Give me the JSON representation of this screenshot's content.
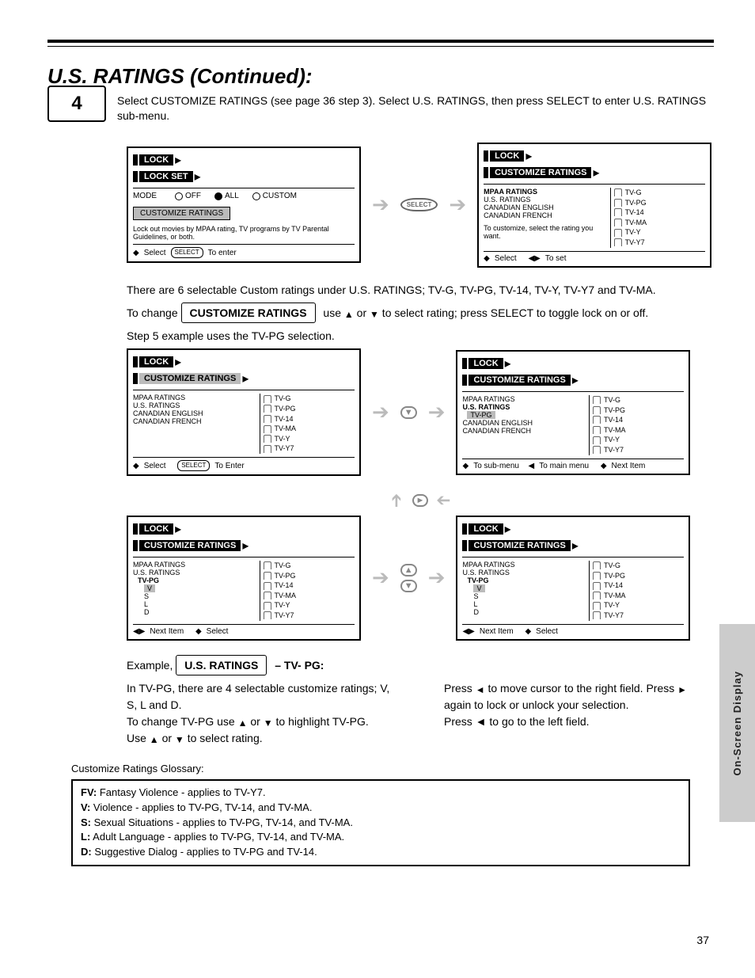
{
  "header": "U.S. RATINGS (Continued):",
  "sidebar_label": "On-Screen Display",
  "step": {
    "num": "4",
    "text": "Select CUSTOMIZE RATINGS (see page 36 step 3). Select U.S. RATINGS, then press SELECT to enter U.S. RATINGS sub-menu."
  },
  "p1": "There are 6 selectable Custom ratings under U.S. RATINGS; TV-G, TV-PG, TV-14, TV-Y, TV-Y7 and TV-MA.",
  "change_prefix": "To change",
  "change_boxlabel": "CUSTOMIZE RATINGS",
  "change_suffix_a": " use ",
  "change_suffix_b": " or ",
  "change_suffix_c": " to select rating; press SELECT to toggle lock on or off.",
  "p2": "Step 5 example uses the TV-PG selection.",
  "ex_title_prefix": "Example, ",
  "ex_title_box": "U.S. RATINGS",
  "ex_title_suffix": " – TV- PG:",
  "ex_p1": "In TV-PG, there are 4 selectable customize ratings; V, S, L and D.",
  "ex_change_prefix": "To change TV-PG use ",
  "ex_change_mid": " or ",
  "ex_change_end": " to highlight TV-PG.",
  "ex_p2_a": "Use ",
  "ex_p2_b": " or ",
  "ex_p2_c": " to select rating.",
  "ex_p3_a": " to move cursor to the right field. Press ",
  "ex_p3_b": " again to lock or unlock your selection.",
  "ex_p3_pre": "Press ",
  "ex_p4": "Press ◄ to go to the left field.",
  "gloss_line": "Customize Ratings Glossary:",
  "gloss": {
    "fv": {
      "term": "FV:",
      "desc": " Fantasy Violence - applies to TV-Y7."
    },
    "v": {
      "term": "V:",
      "desc": " Violence - applies to TV-PG, TV-14, and TV-MA."
    },
    "s": {
      "term": "S:",
      "desc": " Sexual Situations - applies to TV-PG, TV-14, and TV-MA."
    },
    "l": {
      "term": "L:",
      "desc": " Adult Language - applies to TV-PG, TV-14, and TV-MA."
    },
    "d": {
      "term": "D:",
      "desc": " Suggestive Dialog - applies to TV-PG and TV-14."
    }
  },
  "pagenum": "37",
  "panelA": {
    "title": "LOCK SET",
    "crumb1": "LOCK",
    "crumb2": "LOCK SET",
    "opts_label": "MODE",
    "opts": [
      "OFF",
      "ALL",
      "CUSTOM"
    ],
    "btn": "CUSTOMIZE RATINGS",
    "block_hint": "Lock out movies by MPAA rating, TV programs by TV Parental Guidelines, or both.",
    "nav_sel": "Select",
    "nav_action": "To enter",
    "nav_btn": "SELECT"
  },
  "panelB": {
    "title": "CUSTOMIZE RATINGS",
    "crumb1": "LOCK",
    "crumb2": "CUSTOMIZE RATINGS",
    "rows": [
      "MPAA RATINGS",
      "U.S. RATINGS",
      "CANADIAN ENGLISH",
      "CANADIAN FRENCH"
    ],
    "hint": "To customize, select the rating you want.",
    "locks": [
      "TV-G",
      "TV-PG",
      "TV-14",
      "TV-MA",
      "TV-Y",
      "TV-Y7"
    ],
    "nav_sel": "Select",
    "nav_action": "To set"
  },
  "panelC": {
    "title": "CUSTOMIZE RATINGS",
    "crumb1": "LOCK",
    "crumb2hl": "CUSTOMIZE RATINGS",
    "rows": [
      "MPAA RATINGS",
      "U.S. RATINGS",
      "CANADIAN ENGLISH",
      "CANADIAN FRENCH"
    ],
    "locks": [
      "TV-G",
      "TV-PG",
      "TV-14",
      "TV-MA",
      "TV-Y",
      "TV-Y7"
    ],
    "nav_sel": "Select",
    "nav_action": "To Enter",
    "nav_btn": "SELECT"
  },
  "panelD": {
    "title": "CUSTOMIZE RATINGS",
    "crumb1": "LOCK",
    "crumb2": "CUSTOMIZE RATINGS",
    "rows": [
      "MPAA RATINGS",
      "U.S. RATINGS",
      "CANADIAN ENGLISH",
      "CANADIAN FRENCH"
    ],
    "sub": "TV-PG",
    "locks": [
      "TV-G",
      "TV-PG",
      "TV-14",
      "TV-MA",
      "TV-Y",
      "TV-Y7"
    ],
    "nav_a": "To sub-menu",
    "nav_b": "To main menu",
    "nav_c": "Next Item"
  },
  "panelE": {
    "title": "CUSTOMIZE RATINGS",
    "crumb1": "LOCK",
    "crumb2": "CUSTOMIZE RATINGS",
    "rows": [
      "MPAA RATINGS",
      "U.S. RATINGS",
      "CANADIAN ENGLISH",
      "CANADIAN FRENCH"
    ],
    "sub": "TV-PG",
    "subitems": [
      "V",
      "S",
      "L",
      "D"
    ],
    "locks": [
      "TV-G",
      "TV-PG",
      "TV-14",
      "TV-MA",
      "TV-Y",
      "TV-Y7"
    ],
    "nav_a": "Next Item",
    "nav_b": "Select"
  },
  "panelF": {
    "title": "CUSTOMIZE RATINGS",
    "crumb1": "LOCK",
    "crumb2": "CUSTOMIZE RATINGS",
    "rows": [
      "MPAA RATINGS",
      "U.S. RATINGS",
      "CANADIAN ENGLISH",
      "CANADIAN FRENCH"
    ],
    "sub": "TV-PG",
    "subitems": [
      "V",
      "S",
      "L",
      "D"
    ],
    "locks": [
      "TV-G",
      "TV-PG",
      "TV-14",
      "TV-MA",
      "TV-Y",
      "TV-Y7"
    ],
    "nav_a": "Next Item",
    "nav_b": "Select"
  },
  "select_label": "SELECT",
  "glyph": {
    "up": "▲",
    "down": "▼",
    "left": "◄",
    "right": "►"
  }
}
